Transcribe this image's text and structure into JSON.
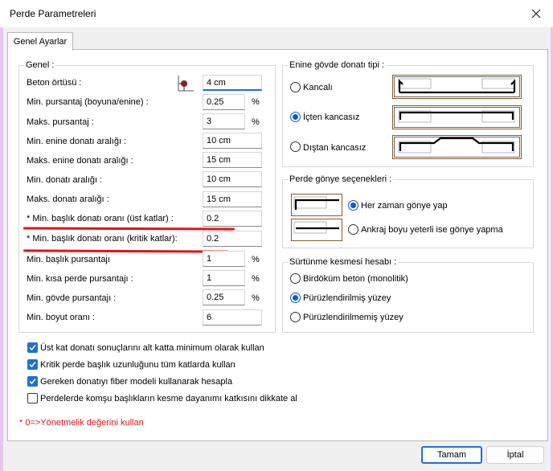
{
  "window": {
    "title": "Perde Parametreleri"
  },
  "tab": {
    "label": "Genel Ayarlar"
  },
  "genel": {
    "title": "Genel :",
    "rows": [
      {
        "label": "Beton örtüsü :",
        "value": "4 cm",
        "unit": ""
      },
      {
        "label": "Min. pursantaj (boyuna/enine) :",
        "value": "0.25",
        "unit": "%"
      },
      {
        "label": "Maks. pursantaj :",
        "value": "3",
        "unit": "%"
      },
      {
        "label": "Min. enine donatı aralığı :",
        "value": "10 cm",
        "unit": ""
      },
      {
        "label": "Maks. enine donatı aralığı :",
        "value": "15 cm",
        "unit": ""
      },
      {
        "label": "Min. donatı aralığı :",
        "value": "10 cm",
        "unit": ""
      },
      {
        "label": "Maks. donatı aralığı :",
        "value": "15 cm",
        "unit": ""
      },
      {
        "label": "* Min. başlık donatı oranı (üst katlar) :",
        "value": "0.2",
        "unit": ""
      },
      {
        "label": "* Min. başlık donatı oranı (kritik katlar):",
        "value": "0.2",
        "unit": ""
      },
      {
        "label": "Min. başlık pursantajı",
        "value": "1",
        "unit": "%"
      },
      {
        "label": "Min. kısa perde pursantajı :",
        "value": "1",
        "unit": "%"
      },
      {
        "label": "Min. gövde pursantajı :",
        "value": "0.25",
        "unit": "%"
      },
      {
        "label": "Min. boyut oranı :",
        "value": "6",
        "unit": ""
      }
    ]
  },
  "enine": {
    "title": "Enine gövde donatı tipi :",
    "options": [
      {
        "label": "Kancalı",
        "selected": false
      },
      {
        "label": "İçten kancasız",
        "selected": true
      },
      {
        "label": "Dıştan kancasız",
        "selected": false
      }
    ]
  },
  "gonye": {
    "title": "Perde gönye seçenekleri :",
    "options": [
      {
        "label": "Her zaman gönye yap",
        "selected": true
      },
      {
        "label": "Ankraj boyu yeterli ise gönye yapma",
        "selected": false
      }
    ]
  },
  "surtunme": {
    "title": "Sürtünme kesmesi hesabı :",
    "options": [
      {
        "label": "Birdöküm beton (monolitik)",
        "selected": false
      },
      {
        "label": "Pürüzlendirilmiş yüzey",
        "selected": true
      },
      {
        "label": "Pürüzlendirilmemiş yüzey",
        "selected": false
      }
    ]
  },
  "checks": [
    {
      "label": "Üst kat donatı sonuçlarını alt katta minimum olarak kullan",
      "checked": true
    },
    {
      "label": "Kritik perde başlık uzunluğunu tüm katlarda kullan",
      "checked": true
    },
    {
      "label": "Gereken donatıyı fiber modeli kullanarak hesapla",
      "checked": true
    },
    {
      "label": "Perdelerde komşu başlıkların kesme dayanımı katkısını dikkate al",
      "checked": false
    }
  ],
  "note": "* 0=>Yönetmelik değerini kullan",
  "buttons": {
    "ok": "Tamam",
    "cancel": "İptal"
  },
  "colors": {
    "accent": "#1f6fd1",
    "note": "#e31313",
    "annotation": "#e31313"
  }
}
